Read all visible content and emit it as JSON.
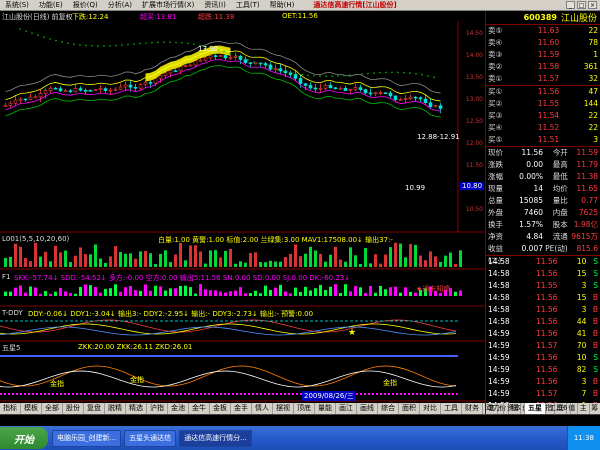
{
  "menu": {
    "items": [
      "系统(S)",
      "功能(E)",
      "报价(Q)",
      "分析(A)",
      "扩展市场行情(X)",
      "资讯(I)",
      "工具(T)",
      "帮助(H)"
    ],
    "title": "通达信高速行情[江山股份]"
  },
  "chart_header": {
    "title": "江山股份(日线) 前复权",
    "low_label": "下跌:12.24",
    "high_label": "超买:13.81",
    "rank_label": "超跌:11.38",
    "end_label": "OET:11.56"
  },
  "price_annotations": {
    "peak": "13.30",
    "range": "12.88-12.91",
    "last": "10.99",
    "y_tag": "10.80"
  },
  "price_axis": [
    "14.50",
    "14.00",
    "13.50",
    "13.00",
    "12.50",
    "12.00",
    "11.50",
    "11.00",
    "10.50"
  ],
  "ind1": {
    "name": "L001(5,5,10,20,60)",
    "text": "白量:1.00 黄警:1.00 标值:2.00 兰绿集:3.00 MAV1:17508.00↓ 输出37:-"
  },
  "ind2": {
    "name": "F1",
    "text": "SKK:-57.74↓ SDD:-54.52↓ 多方:-0.00 空方:0.00 输出5:11.56 SN:0.00 SD:0.00 SJ:0.00 DK:-60.23↓",
    "tag": "★通卡知喷"
  },
  "ind3": {
    "name": "T-DDY",
    "text": "DDY:-0.06↓ DDY1:-3.04↓ 输出3:- DDY2:-2.95↓ 输出:- DDY3:-2.73↓ 输出:- 预警:0.00"
  },
  "ind4": {
    "name": "五星5",
    "text": "ZKK:20.00 ZKK:26.11 ZKD:26.01",
    "marks": [
      "金指",
      "金指",
      "金指"
    ],
    "date_tag": "2009/08/26/三"
  },
  "tabs": [
    "指标",
    "模板",
    "全部",
    "股份",
    "复盘",
    "脱精",
    "精选",
    "沪指",
    "金池",
    "金牛",
    "金板",
    "金手",
    "情人",
    "摆视",
    "顶底",
    "量能",
    "画江",
    "画线",
    "综合",
    "面积",
    "对比",
    "工具",
    "财务",
    "动力",
    "资本",
    "五星",
    "工具6"
  ],
  "active_tab": "五星",
  "stock": {
    "code": "600389",
    "name": "江山股份"
  },
  "sells": [
    {
      "label": "卖⑤",
      "price": "11.63",
      "vol": "22"
    },
    {
      "label": "卖④",
      "price": "11.60",
      "vol": "78"
    },
    {
      "label": "卖③",
      "price": "11.59",
      "vol": "1"
    },
    {
      "label": "卖②",
      "price": "11.58",
      "vol": "361"
    },
    {
      "label": "卖①",
      "price": "11.57",
      "vol": "32"
    }
  ],
  "buys": [
    {
      "label": "买①",
      "price": "11.56",
      "vol": "47"
    },
    {
      "label": "买②",
      "price": "11.55",
      "vol": "144"
    },
    {
      "label": "买③",
      "price": "11.54",
      "vol": "22"
    },
    {
      "label": "买④",
      "price": "11.52",
      "vol": "22"
    },
    {
      "label": "买⑤",
      "price": "11.51",
      "vol": "3"
    }
  ],
  "quote": [
    {
      "k1": "现价",
      "v1": "11.56",
      "k2": "今开",
      "v2": "11.59"
    },
    {
      "k1": "涨跌",
      "v1": "0.00",
      "k2": "最高",
      "v2": "11.79"
    },
    {
      "k1": "涨幅",
      "v1": "0.00%",
      "k2": "最低",
      "v2": "11.38"
    },
    {
      "k1": "现量",
      "v1": "14",
      "k2": "均价",
      "v2": "11.65"
    },
    {
      "k1": "总量",
      "v1": "15085",
      "k2": "量比",
      "v2": "0.77"
    },
    {
      "k1": "外盘",
      "v1": "7460",
      "k2": "内盘",
      "v2": "7625"
    },
    {
      "k1": "换手",
      "v1": "1.57%",
      "k2": "股本",
      "v2": "1.98亿"
    },
    {
      "k1": "净资",
      "v1": "4.84",
      "k2": "流通",
      "v2": "9615万"
    },
    {
      "k1": "收益(二)",
      "v1": "0.007",
      "k2": "PE(动)",
      "v2": "815.6"
    }
  ],
  "ticks": [
    {
      "t": "14:58",
      "p": "11.56",
      "v": "10",
      "s": "S"
    },
    {
      "t": "14:58",
      "p": "11.56",
      "v": "15",
      "s": "S"
    },
    {
      "t": "14:58",
      "p": "11.55",
      "v": "3",
      "s": "S"
    },
    {
      "t": "14:58",
      "p": "11.56",
      "v": "15",
      "s": "B"
    },
    {
      "t": "14:58",
      "p": "11.56",
      "v": "3",
      "s": "B"
    },
    {
      "t": "14:58",
      "p": "11.56",
      "v": "44",
      "s": "B"
    },
    {
      "t": "14:59",
      "p": "11.56",
      "v": "41",
      "s": "B"
    },
    {
      "t": "14:59",
      "p": "11.57",
      "v": "70",
      "s": "B"
    },
    {
      "t": "14:59",
      "p": "11.56",
      "v": "10",
      "s": "S"
    },
    {
      "t": "14:59",
      "p": "11.56",
      "v": "82",
      "s": "S"
    },
    {
      "t": "14:59",
      "p": "11.56",
      "v": "3",
      "s": "B"
    },
    {
      "t": "14:59",
      "p": "11.57",
      "v": "7",
      "s": "B"
    },
    {
      "t": "14:59",
      "p": "11.56",
      "v": "1",
      "s": "B"
    },
    {
      "t": "14:59",
      "p": "11.56",
      "v": "1",
      "s": "B"
    }
  ],
  "right_tabs": [
    "笔",
    "价",
    "细",
    "盘",
    "势",
    "指",
    "联",
    "值",
    "主",
    "筹"
  ],
  "taskbar": {
    "start": "开始",
    "tasks": [
      "电脑乐园_创建新...",
      "五星头通达信",
      "通达信高速行情分..."
    ],
    "time": "11:38"
  },
  "colors": {
    "up": "#ff3c3c",
    "down": "#00e0e0",
    "gold": "#ffd700",
    "green": "#00ff40",
    "magenta": "#ff00ff",
    "yellow": "#ffff00",
    "blue": "#4060ff"
  }
}
